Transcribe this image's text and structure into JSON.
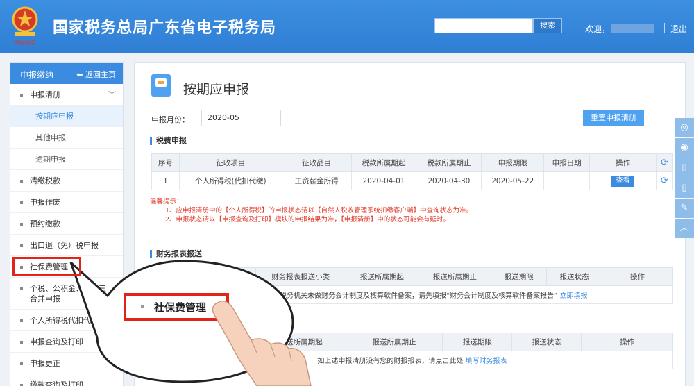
{
  "header": {
    "title": "国家税务总局广东省电子税务局",
    "search_button": "搜索",
    "welcome": "欢迎，",
    "logout": "退出"
  },
  "sidebar": {
    "head_title": "申报缴纳",
    "back_home": "返回主页",
    "items": [
      {
        "label": "申报清册"
      },
      {
        "label": "按期应申报"
      },
      {
        "label": "其他申报"
      },
      {
        "label": "逾期申报"
      },
      {
        "label": "清缴税款"
      },
      {
        "label": "申报作废"
      },
      {
        "label": "预约缴款"
      },
      {
        "label": "出口退（免）税申报"
      },
      {
        "label": "社保费管理"
      },
      {
        "label": "个税、公积金、社保三"
      },
      {
        "label": "合并申报"
      },
      {
        "label": "个人所得税代扣代缴"
      },
      {
        "label": "申报查询及打印"
      },
      {
        "label": "申报更正"
      },
      {
        "label": "缴款查询及打印"
      }
    ]
  },
  "main": {
    "page_title": "按期应申报",
    "period_label": "申报月份：",
    "period_value": "2020-05",
    "reset_button": "重置申报清册",
    "tax_section": "税费申报",
    "tax_headers": [
      "序号",
      "征收项目",
      "征收品目",
      "税款所属期起",
      "税款所属期止",
      "申报期限",
      "申报日期",
      "操作"
    ],
    "tax_row": {
      "index": "1",
      "item": "个人所得税(代扣代缴)",
      "subitem": "工资薪金所得",
      "start": "2020-04-01",
      "end": "2020-04-30",
      "deadline": "2020-05-22",
      "date": "",
      "action": "查看"
    },
    "tips_title": "温馨提示：",
    "tips": [
      "1、应申报清册中的【个人所得税】的申报状态请以【自然人税收管理系统扣缴客户端】中查询状态为准。",
      "2、申报状态请以【申报查询及打印】模块的申报结果为准，【申报清册】中的状态可能会有延时。"
    ],
    "finance_section": "财务报表报送",
    "finance_headers": [
      "财务报表报送小类",
      "报送所属期起",
      "报送所属期止",
      "报送期限",
      "报送状态",
      "操作"
    ],
    "finance_note": "税主管税务机关未做财务会计制度及核算软件备案，请先填报“财务会计制度及核算软件备案报告”",
    "finance_link": "立即填报",
    "report_headers": [
      "报送所属期起",
      "报送所属期止",
      "报送期限",
      "报送状态",
      "操作"
    ],
    "report_note": "如上述申报清册没有您的财报报表，请点击此处",
    "report_link": "填写财务报表"
  },
  "callout": {
    "label": "社保费管理"
  },
  "colors": {
    "header_blue": "#3d8fe0",
    "accent": "#3b8be0",
    "highlight_red": "#e2231a",
    "tips_red": "#e23a2a"
  }
}
